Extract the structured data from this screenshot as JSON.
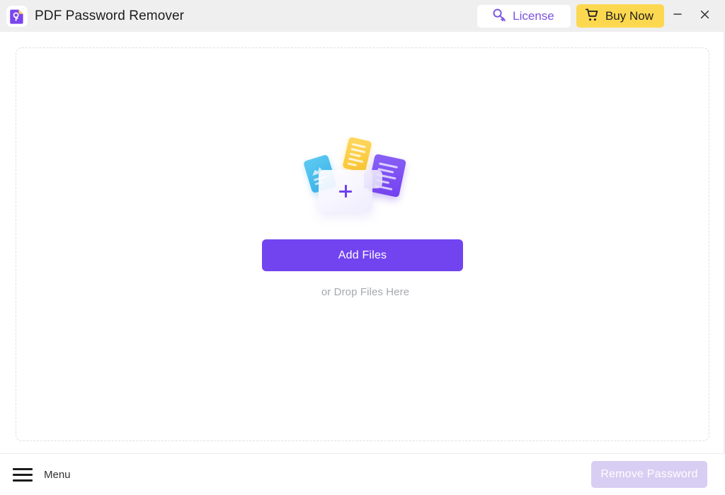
{
  "window": {
    "title": "PDF Password Remover",
    "app_icon": "pdf-lock-icon",
    "accent_purple": "#7244f0",
    "accent_yellow": "#fcd850",
    "titlebar_bg": "#efefef"
  },
  "titlebar": {
    "license_button": {
      "label": "License",
      "icon": "key-icon",
      "text_color": "#7b52e0",
      "bg_color": "#ffffff"
    },
    "buy_button": {
      "label": "Buy Now",
      "icon": "shopping-cart-icon",
      "text_color": "#201f1c",
      "bg_color": "#fcd850"
    },
    "minimize": {
      "icon": "minimize-icon",
      "label": "—"
    },
    "close": {
      "icon": "close-icon",
      "label": "×"
    }
  },
  "main": {
    "dropzone": {
      "illustration": {
        "documents": [
          {
            "name": "blue-document",
            "color": "#35b4e8"
          },
          {
            "name": "yellow-document",
            "color": "#f9c52f"
          },
          {
            "name": "purple-document",
            "color": "#7340ef"
          }
        ],
        "card": {
          "name": "add-file-card",
          "plus_color": "#6f3ff0"
        }
      },
      "add_files_label": "Add Files",
      "drop_hint": "or Drop Files Here"
    }
  },
  "footer": {
    "menu": {
      "label": "Menu",
      "icon": "hamburger-icon"
    },
    "remove_password": {
      "label": "Remove Password",
      "enabled": false,
      "bg_color": "#d8cdf2",
      "text_color": "#ffffff"
    }
  }
}
